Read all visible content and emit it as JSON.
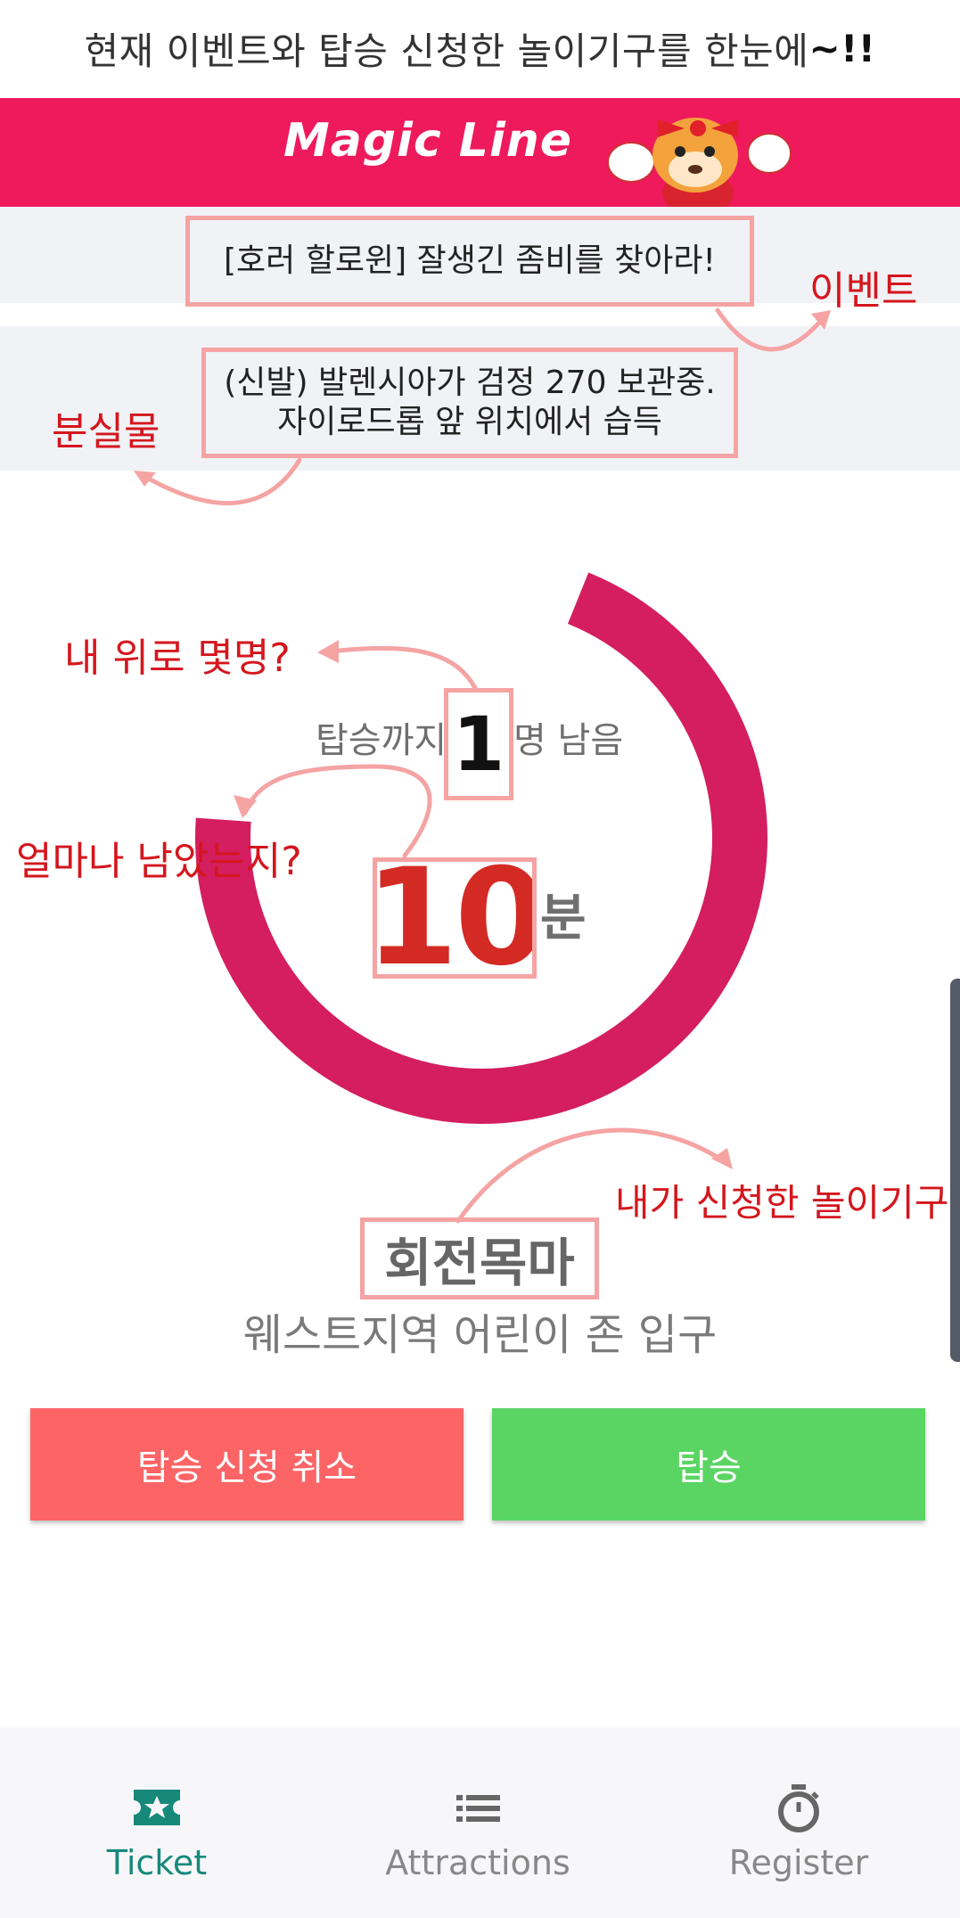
{
  "top_caption": {
    "text": "현재 이벤트와 탑승 신청한 놀이기구를 한눈에",
    "emph": "~!!"
  },
  "header": {
    "brand": "Magic Line"
  },
  "event": {
    "text": "[호러 할로윈] 잘생긴 좀비를 찾아라!",
    "annotation": "이벤트"
  },
  "lost_item": {
    "line1": "(신발) 발렌시아가 검정 270 보관중.",
    "line2": "자이로드롭 앞 위치에서 습득",
    "annotation": "분실물"
  },
  "queue": {
    "prefix": "탑승까지",
    "count": "1",
    "suffix": "명 남음",
    "count_annotation": "내 위로 몇명?",
    "minutes": "10",
    "minutes_unit": "분",
    "minutes_annotation": "얼마나 남았는지?",
    "progress_fraction": 0.7
  },
  "ride": {
    "name": "회전목마",
    "location": "웨스트지역 어린이 존 입구",
    "annotation": "내가 신청한 놀이기구"
  },
  "buttons": {
    "cancel": "탑승 신청 취소",
    "board": "탑승"
  },
  "nav": [
    {
      "label": "Ticket",
      "icon": "ticket-star-icon",
      "active": true
    },
    {
      "label": "Attractions",
      "icon": "list-icon",
      "active": false
    },
    {
      "label": "Register",
      "icon": "stopwatch-icon",
      "active": false
    }
  ],
  "colors": {
    "brand": "#ee1a5c",
    "ring": "#d41e5f",
    "cancel": "#fc6466",
    "board": "#5ad563",
    "active_nav": "#16897a",
    "annotation": "#d4161d"
  }
}
